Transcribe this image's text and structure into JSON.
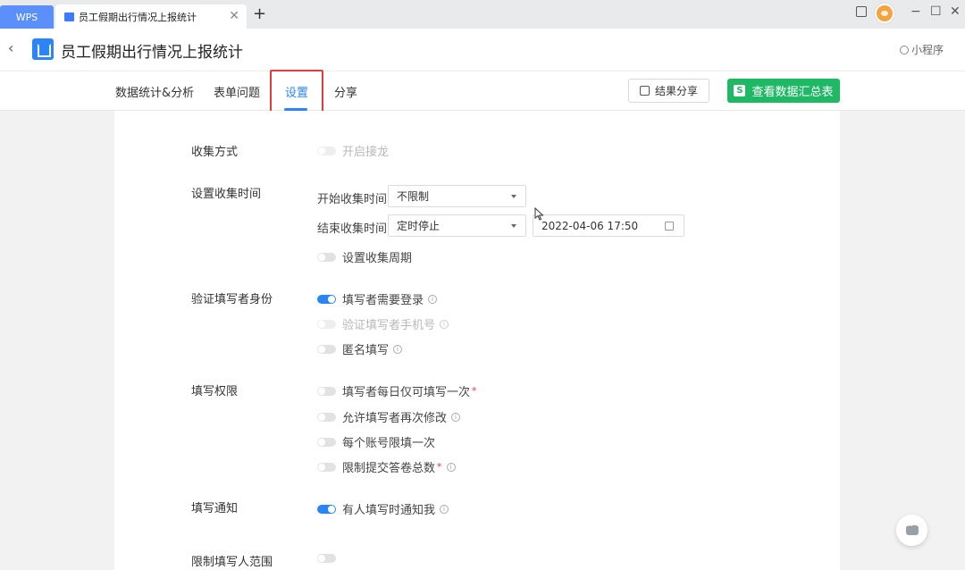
{
  "tabbar": {
    "app_label": "WPS",
    "doc_tab_label": "员工假期出行情况上报统计",
    "close_glyph": "✕",
    "new_tab_glyph": "+"
  },
  "window_controls": {
    "minimize": "−",
    "maximize": "☐",
    "close": "✕"
  },
  "header": {
    "back_glyph": "‹",
    "title": "员工假期出行情况上报统计",
    "mini_program": "小程序"
  },
  "nav": {
    "tabs": [
      {
        "label": "数据统计&分析",
        "active": false
      },
      {
        "label": "表单问题",
        "active": false
      },
      {
        "label": "设置",
        "active": true
      },
      {
        "label": "分享",
        "active": false
      }
    ],
    "share_button": "结果分享",
    "view_button": "查看数据汇总表",
    "view_button_badge": "S",
    "accent": "#2a86f8",
    "green": "#1fb865",
    "highlight": "#e03c3c"
  },
  "settings": {
    "collect_method": {
      "label": "收集方式",
      "items": [
        {
          "label": "开启接龙",
          "on": false,
          "disabled": true
        }
      ]
    },
    "collect_time": {
      "label": "设置收集时间",
      "start_label": "开始收集时间",
      "start_value": "不限制",
      "end_label": "结束收集时间",
      "end_value": "定时停止",
      "end_datetime": "2022-04-06 17:50",
      "period": {
        "label": "设置收集周期",
        "on": false
      }
    },
    "identity": {
      "label": "验证填写者身份",
      "items": [
        {
          "label": "填写者需要登录",
          "on": true,
          "info": true
        },
        {
          "label": "验证填写者手机号",
          "on": false,
          "disabled": true,
          "info": true
        },
        {
          "label": "匿名填写",
          "on": false,
          "info": true
        }
      ]
    },
    "permission": {
      "label": "填写权限",
      "items": [
        {
          "label": "填写者每日仅可填写一次",
          "on": false,
          "required": true
        },
        {
          "label": "允许填写者再次修改",
          "on": false,
          "info": true
        },
        {
          "label": "每个账号限填一次",
          "on": false
        },
        {
          "label": "限制提交答卷总数",
          "on": false,
          "required": true,
          "info": true
        }
      ]
    },
    "notify": {
      "label": "填写通知",
      "items": [
        {
          "label": "有人填写时通知我",
          "on": true,
          "info": true
        }
      ]
    },
    "scope": {
      "label": "限制填写人范围",
      "on": false
    }
  },
  "icons": {
    "info_glyph": "i",
    "required_glyph": "*"
  }
}
